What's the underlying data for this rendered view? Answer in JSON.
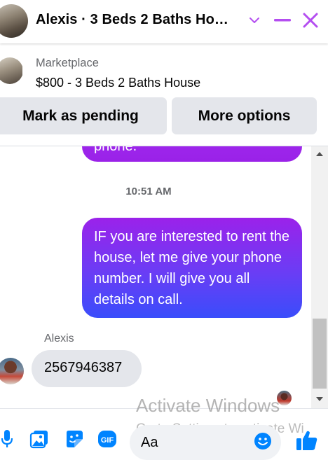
{
  "header": {
    "title": "Alexis · 3 Beds 2 Baths Ho…",
    "icons": [
      "chevron-down-icon",
      "minimize-icon",
      "close-icon"
    ],
    "accent_color": "#b44ef0"
  },
  "listing": {
    "label": "Marketplace",
    "title": "$800 - 3 Beds 2 Baths House"
  },
  "actions": {
    "pending_label": "Mark as pending",
    "more_label": "More options"
  },
  "conversation": {
    "partial_message": "phone.",
    "timestamp": "10:51 AM",
    "outgoing_message": "IF you are interested to rent the house, let me give your phone number. I will give you all details on call.",
    "sender_name": "Alexis",
    "incoming_message": "2567946387"
  },
  "composer": {
    "placeholder": "Aa",
    "tools": [
      "microphone-icon",
      "photo-icon",
      "sticker-icon",
      "gif-icon",
      "emoji-icon",
      "thumbs-up-icon"
    ],
    "brand_color": "#0084ff"
  },
  "watermark": {
    "title": "Activate Windows",
    "subtitle": "Go to Settings to activate Wi"
  }
}
